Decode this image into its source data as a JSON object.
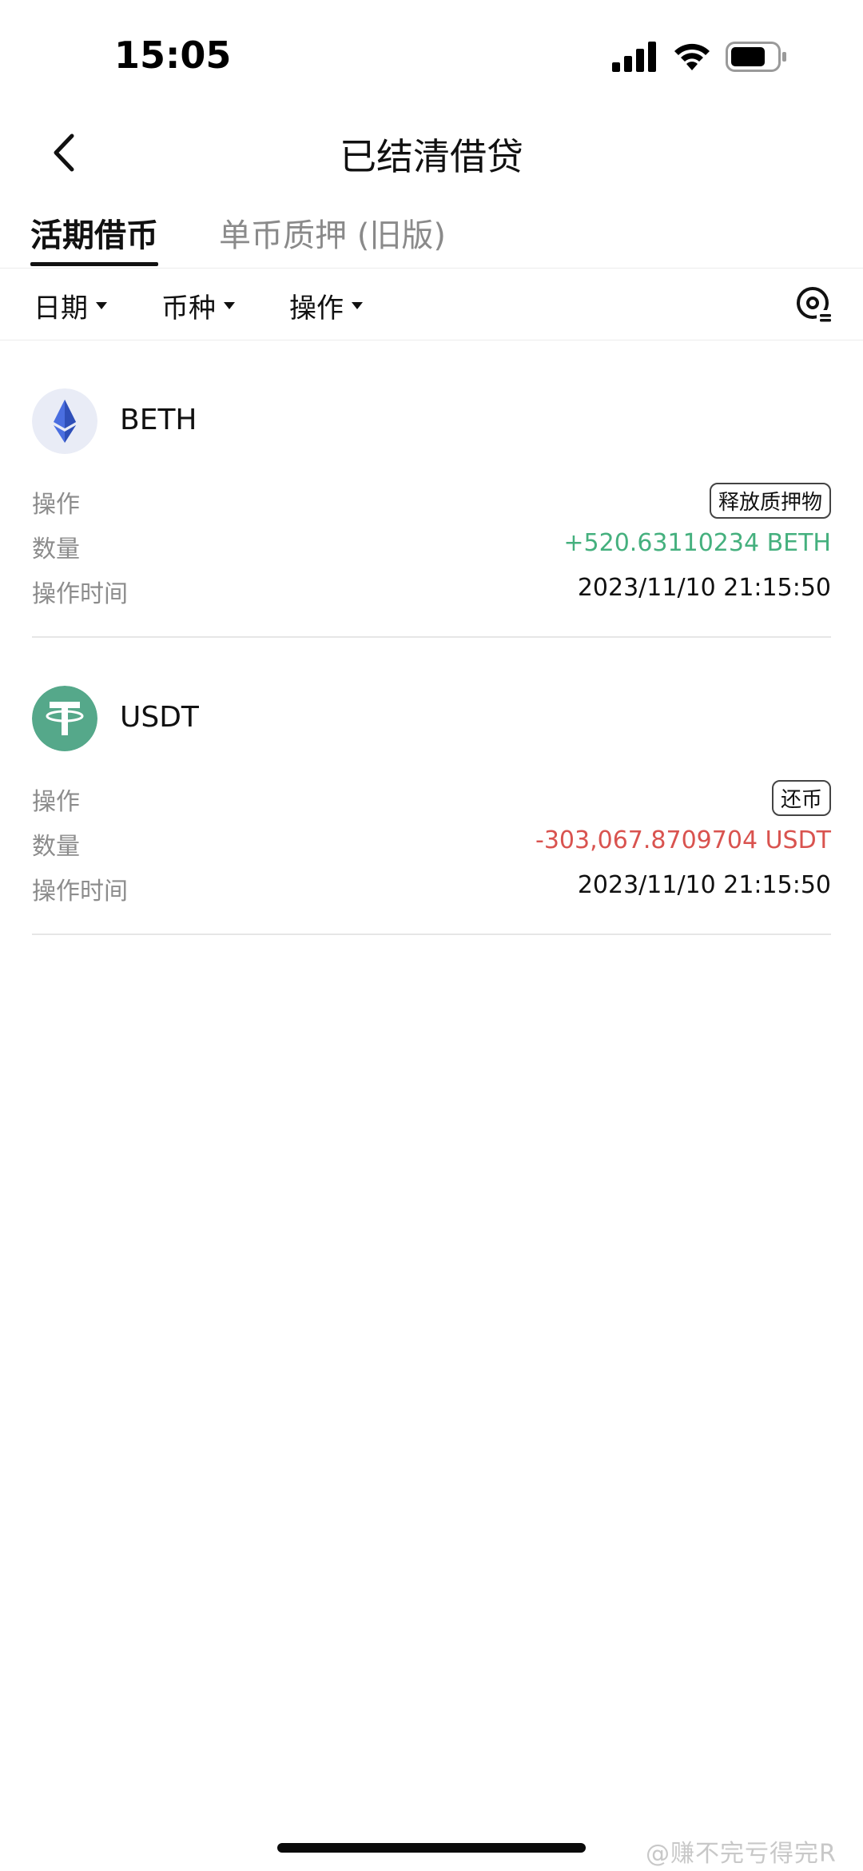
{
  "status_bar": {
    "time": "15:05"
  },
  "header": {
    "title": "已结清借贷"
  },
  "tabs": [
    {
      "label": "活期借币",
      "active": true
    },
    {
      "label": "单币质押 (旧版)",
      "active": false
    }
  ],
  "filters": [
    {
      "label": "日期"
    },
    {
      "label": "币种"
    },
    {
      "label": "操作"
    }
  ],
  "records": [
    {
      "coin": "BETH",
      "icon": "ethereum-icon",
      "rows": [
        {
          "label": "操作",
          "value": "释放质押物",
          "style": "badge"
        },
        {
          "label": "数量",
          "value": "+520.63110234 BETH",
          "style": "positive"
        },
        {
          "label": "操作时间",
          "value": "2023/11/10 21:15:50",
          "style": "plain"
        }
      ]
    },
    {
      "coin": "USDT",
      "icon": "tether-icon",
      "rows": [
        {
          "label": "操作",
          "value": "还币",
          "style": "badge"
        },
        {
          "label": "数量",
          "value": "-303,067.8709704 USDT",
          "style": "negative"
        },
        {
          "label": "操作时间",
          "value": "2023/11/10 21:15:50",
          "style": "plain"
        }
      ]
    }
  ],
  "watermark": "@赚不完亏得完R",
  "colors": {
    "positive": "#45b07e",
    "negative": "#d9534f",
    "tether": "#55a88a",
    "ethereum_bg": "#e9ecf6",
    "ethereum": "#4a6ee0"
  }
}
